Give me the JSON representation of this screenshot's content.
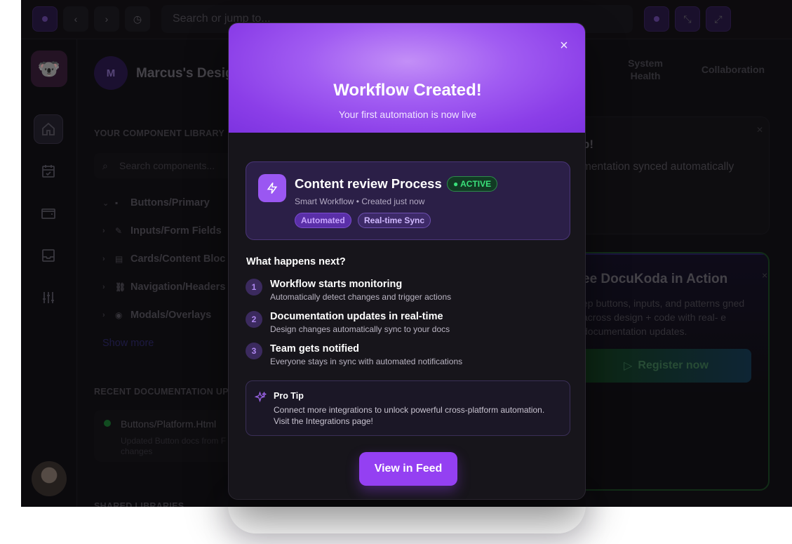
{
  "topbar": {
    "search_placeholder": "Search or jump to..."
  },
  "rail": {
    "logo": "🐨"
  },
  "workspace": {
    "avatar_initial": "M",
    "title": "Marcus's Desig"
  },
  "tabs": [
    {
      "label": "System\nHealth"
    },
    {
      "label": "Collaboration"
    }
  ],
  "library": {
    "heading": "YOUR COMPONENT LIBRARY",
    "search_placeholder": "Search components...",
    "items": [
      {
        "label": "Buttons/Primary",
        "icon": "▪"
      },
      {
        "label": "Inputs/Form Fields",
        "icon": "✎"
      },
      {
        "label": "Cards/Content Bloc",
        "icon": "▤"
      },
      {
        "label": "Navigation/Headers",
        "icon": "⛓"
      },
      {
        "label": "Modals/Overlays",
        "icon": "◉"
      }
    ],
    "show_more": "Show more"
  },
  "recent": {
    "heading": "RECENT DOCUMENTATION UP",
    "item_title": "Buttons/Platform.Html",
    "item_desc": "Updated Button docs from F",
    "item_desc2": "changes"
  },
  "shared": {
    "heading": "SHARED LIBRARIES"
  },
  "right_card": {
    "title": "b!",
    "text": "mentation synced automatically"
  },
  "promo": {
    "title": "ee DocuKoda in Action",
    "text": "ep buttons, inputs, and patterns gned across design + code with real- e documentation updates.",
    "button": "Register now",
    "close": "×"
  },
  "modal": {
    "close": "×",
    "title": "Workflow Created!",
    "subtitle": "Your first automation is now live",
    "workflow": {
      "title": "Content review Process",
      "badge": "● ACTIVE",
      "meta": "Smart Workflow • Created just now",
      "chips": [
        "Automated",
        "Real-time Sync"
      ]
    },
    "next_heading": "What happens next?",
    "steps": [
      {
        "num": "1",
        "title": "Workflow starts monitoring",
        "desc": "Automatically detect changes and trigger actions"
      },
      {
        "num": "2",
        "title": "Documentation updates in real-time",
        "desc": "Design changes automatically sync to your docs"
      },
      {
        "num": "3",
        "title": "Team gets notified",
        "desc": "Everyone stays in sync with automated notifications"
      }
    ],
    "tip": {
      "title": "Pro Tip",
      "text": "Connect more integrations to unlock powerful cross-platform automation. Visit the Integrations page!"
    },
    "cta": "View in Feed"
  },
  "colors": {
    "accent": "#9440f2",
    "header_gradient_center": "#c38ff7",
    "active_green": "#3ae07a",
    "background": "#141218"
  }
}
